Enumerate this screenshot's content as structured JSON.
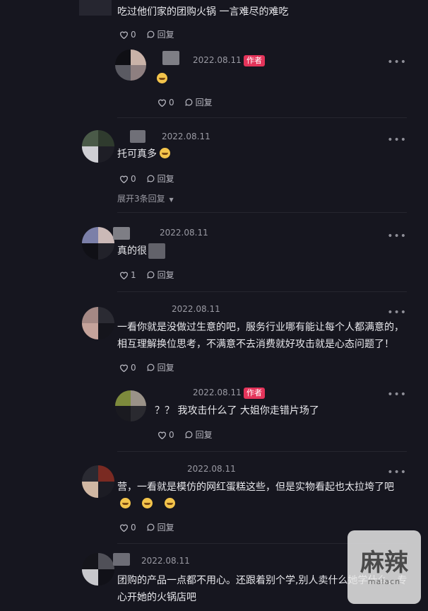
{
  "comments": [
    {
      "text": "吃过他们家的团购火锅 一言难尽的难吃",
      "likes": "0",
      "reply_label": "回复"
    },
    {
      "date": "2022.08.11",
      "author_tag": "作者",
      "likes": "0",
      "reply_label": "回复"
    },
    {
      "date": "2022.08.11",
      "text": "托可真多",
      "likes": "0",
      "reply_label": "回复",
      "expand_label": "展开3条回复"
    },
    {
      "date": "2022.08.11",
      "text": "真的很",
      "likes": "1",
      "reply_label": "回复"
    },
    {
      "date": "2022.08.11",
      "text_line1": "一看你就是没做过生意的吧，服务行业哪有能让每个人都满意的，",
      "text_line2": "相互理解换位思考，不满意不去消费就好攻击就是心态问题了！",
      "likes": "0",
      "reply_label": "回复"
    },
    {
      "date": "2022.08.11",
      "author_tag": "作者",
      "text": "？？ 我攻击什么了 大姐你走错片场了",
      "likes": "0",
      "reply_label": "回复"
    },
    {
      "date": "2022.08.11",
      "text": "营，一看就是模仿的网红蛋糕这些，但是实物看起也太拉垮了吧",
      "likes": "0",
      "reply_label": "回复"
    },
    {
      "date": "2022.08.11",
      "text_line1": "团购的产品一点都不用心。还跟着别个学,别人卖什么她学什么。专",
      "text_line2": "心开她的火锅店吧"
    }
  ],
  "more_icon": "more-dots-icon",
  "watermark": {
    "title": "麻辣",
    "sub": "malacn"
  },
  "colors": {
    "background": "#16161f",
    "author_tag": "#e4345a",
    "emoji": "#f3c44b"
  }
}
